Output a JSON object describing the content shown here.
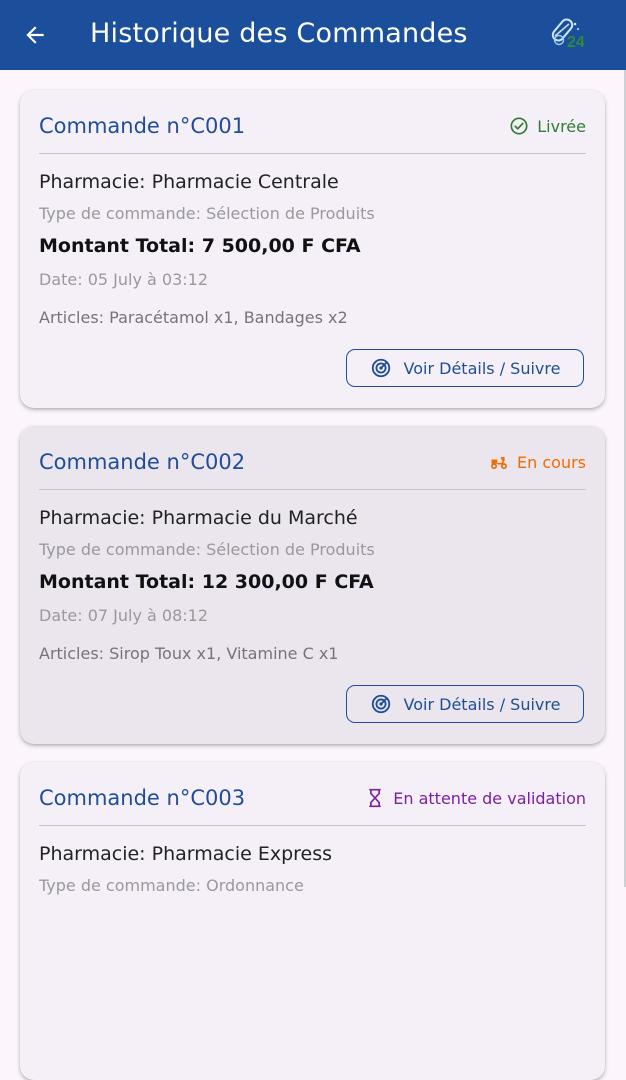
{
  "header": {
    "title": "Historique des Commandes",
    "back_icon": "arrow-back-icon",
    "logo_icon": "pharmacy-logo-icon",
    "background": "#1b4f9b"
  },
  "orders": [
    {
      "id": "Commande n°C001",
      "status": {
        "label": "Livrée",
        "icon": "check-circle-icon",
        "color": "#2e7d32"
      },
      "pharmacy": "Pharmacie: Pharmacie Centrale",
      "type": "Type de commande: Sélection de Produits",
      "amount": "Montant Total: 7 500,00 F CFA",
      "date": "Date: 05 July à 03:12",
      "items": "Articles: Paracétamol x1, Bandages x2",
      "button": "Voir Détails / Suivre"
    },
    {
      "id": "Commande n°C002",
      "status": {
        "label": "En cours",
        "icon": "delivery-scooter-icon",
        "color": "#ef6c00"
      },
      "pharmacy": "Pharmacie: Pharmacie du Marché",
      "type": "Type de commande: Sélection de Produits",
      "amount": "Montant Total: 12 300,00 F CFA",
      "date": "Date: 07 July à 08:12",
      "items": "Articles: Sirop Toux x1, Vitamine C x1",
      "button": "Voir Détails / Suivre"
    },
    {
      "id": "Commande n°C003",
      "status": {
        "label": "En attente de validation",
        "icon": "hourglass-icon",
        "color": "#7b1fa2"
      },
      "pharmacy": "Pharmacie: Pharmacie Express",
      "type": "Type de commande: Ordonnance"
    }
  ],
  "colors": {
    "accent": "#1f4e96",
    "muted": "#9a979d"
  }
}
